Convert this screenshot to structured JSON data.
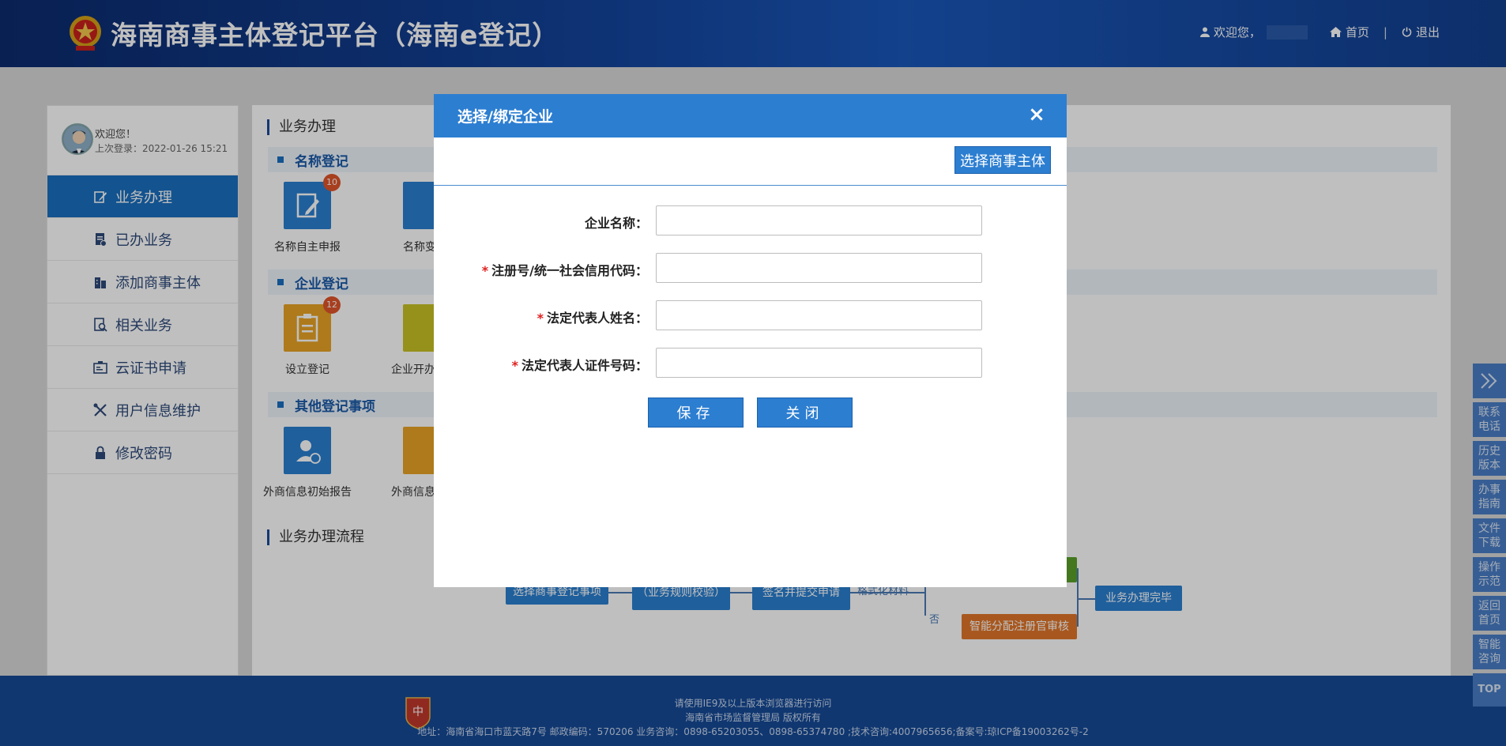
{
  "header": {
    "title": "海南商事主体登记平台（海南e登记）",
    "welcome": "欢迎您，",
    "home": "首页",
    "sep": "|",
    "logout": "退出"
  },
  "sidebar": {
    "welcome": "欢迎您！",
    "last_login": "上次登录：2022-01-26 15:21",
    "items": [
      {
        "label": "业务办理",
        "icon": "edit-icon"
      },
      {
        "label": "已办业务",
        "icon": "document-icon"
      },
      {
        "label": "添加商事主体",
        "icon": "building-icon"
      },
      {
        "label": "相关业务",
        "icon": "search-doc-icon"
      },
      {
        "label": "云证书申请",
        "icon": "certificate-icon"
      },
      {
        "label": "用户信息维护",
        "icon": "tools-icon"
      },
      {
        "label": "修改密码",
        "icon": "lock-icon"
      }
    ]
  },
  "main": {
    "section_title": "业务办理",
    "groups": [
      {
        "title": "名称登记",
        "tiles": [
          {
            "label": "名称自主申报",
            "badge": "10"
          },
          {
            "label": "名称变"
          }
        ]
      },
      {
        "title": "企业登记",
        "tiles": [
          {
            "label": "设立登记",
            "badge": "12"
          },
          {
            "label": "企业开办"
          }
        ]
      },
      {
        "title": "其他登记事项",
        "tiles": [
          {
            "label": "外商信息初始报告"
          },
          {
            "label": "外商信息"
          }
        ]
      }
    ],
    "flow_title": "业务办理流程",
    "flow": {
      "step1": "选择商事登记事项",
      "step2": "（业务规则校验）",
      "step3": "签名并提交申请",
      "step4": "智能分配注册官审核",
      "done": "业务办理完毕",
      "branch_no": "否",
      "print": "格式化材料"
    }
  },
  "modal": {
    "title": "选择/绑定企业",
    "close": "×",
    "select_button": "选择商事主体",
    "fields": [
      {
        "label": "企业名称：",
        "required": false,
        "value": ""
      },
      {
        "label": "注册号/统一社会信用代码：",
        "required": true,
        "value": ""
      },
      {
        "label": "法定代表人姓名：",
        "required": true,
        "value": ""
      },
      {
        "label": "法定代表人证件号码：",
        "required": true,
        "value": ""
      }
    ],
    "required_mark": "*",
    "save": "保存",
    "cancel": "关闭"
  },
  "floatbar": {
    "items": [
      "联系电话",
      "历史版本",
      "办事指南",
      "文件下载",
      "操作示范",
      "返回首页",
      "智能咨询"
    ],
    "top": "TOP"
  },
  "footer": {
    "line1": "请使用IE9及以上版本浏览器进行访问",
    "line2": "海南省市场监督管理局 版权所有",
    "line3": "地址：海南省海口市蓝天路7号 邮政编码：570206 业务咨询：0898-65203055、0898-65374780 ;技术咨询:4007965656;备案号:琼ICP备19003262号-2"
  },
  "colors": {
    "primary": "#2c7ed1",
    "header_dark": "#0c2b6e",
    "required": "#e02020",
    "badge": "#e0552a"
  }
}
